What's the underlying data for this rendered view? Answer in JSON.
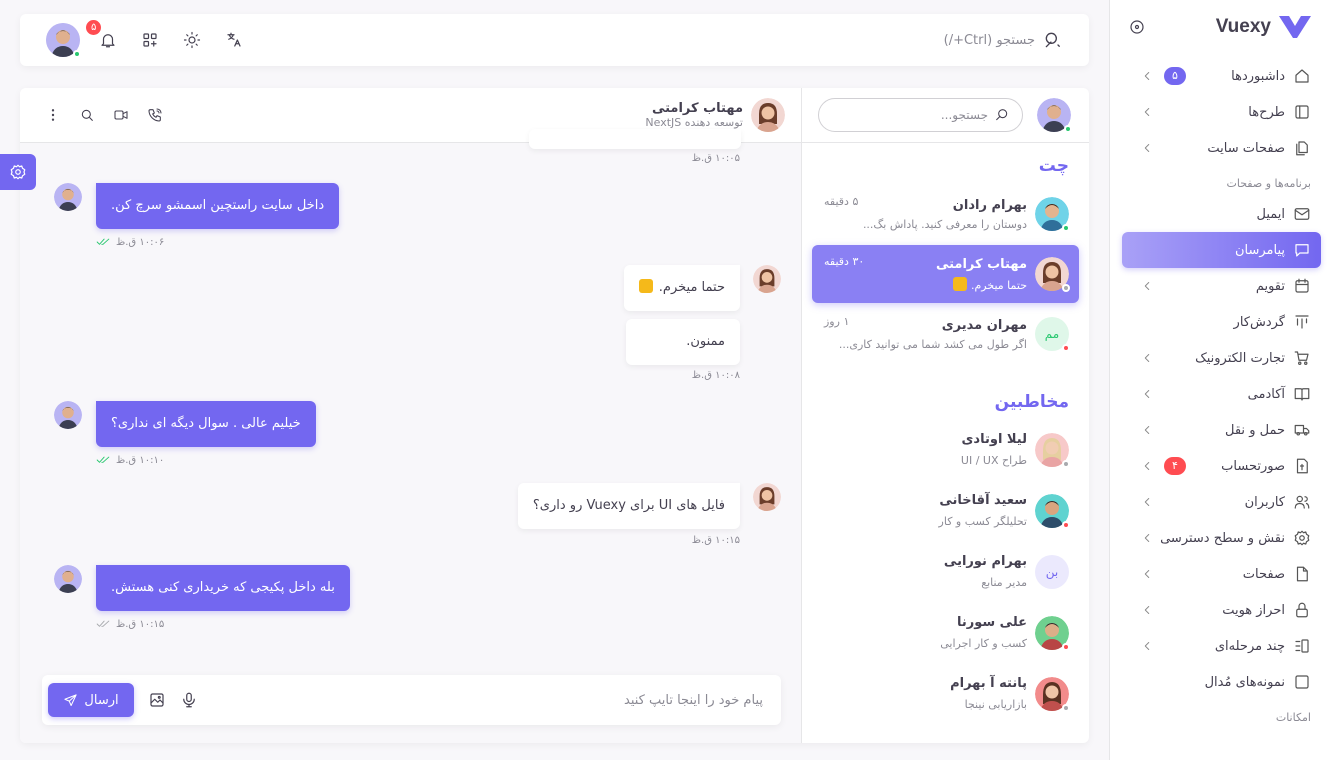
{
  "brand": {
    "name": "Vuexy"
  },
  "sidebar": {
    "items": [
      {
        "label": "داشبوردها",
        "icon": "home-icon",
        "badge": "۵",
        "badge_color": "#7367f0",
        "chevron": true
      },
      {
        "label": "طرح‌ها",
        "icon": "layout-icon",
        "chevron": true
      },
      {
        "label": "صفحات سایت",
        "icon": "files-icon",
        "chevron": true
      }
    ],
    "section_apps": "برنامه‌ها و صفحات",
    "apps": [
      {
        "label": "ایمیل",
        "icon": "mail-icon",
        "chevron": false
      },
      {
        "label": "پیامرسان",
        "icon": "message-icon",
        "chevron": false,
        "active": true
      },
      {
        "label": "تقویم",
        "icon": "calendar-icon",
        "chevron": true
      },
      {
        "label": "گردش‌کار",
        "icon": "kanban-icon",
        "chevron": false
      },
      {
        "label": "تجارت الکترونیک",
        "icon": "cart-icon",
        "chevron": true
      },
      {
        "label": "آکادمی",
        "icon": "book-icon",
        "chevron": true
      },
      {
        "label": "حمل و نقل",
        "icon": "truck-icon",
        "chevron": true
      },
      {
        "label": "صورتحساب",
        "icon": "invoice-icon",
        "badge": "۴",
        "badge_color": "#ff4c51",
        "chevron": true
      },
      {
        "label": "کاربران",
        "icon": "users-icon",
        "chevron": true
      },
      {
        "label": "نقش و سطح دسترسی",
        "icon": "settings-icon",
        "chevron": true
      },
      {
        "label": "صفحات",
        "icon": "file-icon",
        "chevron": true
      },
      {
        "label": "احراز هویت",
        "icon": "lock-icon",
        "chevron": true
      },
      {
        "label": "چند مرحله‌ای",
        "icon": "wizard-icon",
        "chevron": true
      },
      {
        "label": "نمونه‌های مُدال",
        "icon": "square-icon",
        "chevron": false
      }
    ],
    "section_features": "امکانات"
  },
  "topbar": {
    "search_placeholder": "جستجو (Ctrl+/)",
    "notif_count": "۵"
  },
  "contacts_panel": {
    "search_placeholder": "جستجو...",
    "chats_title": "چت",
    "chats": [
      {
        "name": "بهرام رادان",
        "preview": "دوستان را معرفی کنید. پاداش بگ...",
        "time": "۵ دقیقه",
        "status": "online"
      },
      {
        "name": "مهتاب کرامتی",
        "preview": "حتما میخرم.",
        "time": "۳۰ دقیقه",
        "status": "away",
        "active": true
      },
      {
        "name": "مهران مدیری",
        "preview": "اگر طول می کشد شما می توانید کاری...",
        "time": "۱ روز",
        "status": "busy",
        "initials": "مم"
      }
    ],
    "contacts_title": "مخاطبین",
    "contacts": [
      {
        "name": "لیلا اوتادی",
        "role": "طراح UI / UX",
        "status": "away"
      },
      {
        "name": "سعید آقاخانی",
        "role": "تحلیلگر کسب و کار",
        "status": "busy"
      },
      {
        "name": "بهرام نورایی",
        "role": "مدیر منابع",
        "initials": "بن"
      },
      {
        "name": "علی سورنا",
        "role": "کسب و کار اجرایی",
        "status": "busy"
      },
      {
        "name": "پانته آ بهرام",
        "role": "بازاریابی نینجا",
        "status": "away"
      }
    ]
  },
  "conversation": {
    "name": "مهتاب کرامتی",
    "subtitle": "توسعه دهنده NextJS",
    "messages": {
      "t0": "۱۰:۰۵ ق.ظ",
      "m1": "داخل سایت راستچین اسمشو سرچ کن.",
      "t1": "۱۰:۰۶ ق.ظ",
      "m2": "حتما میخرم.",
      "m3": "ممنون.",
      "t2": "۱۰:۰۸ ق.ظ",
      "m4": "خیلیم عالی . سوال دیگه ای نداری؟",
      "t3": "۱۰:۱۰ ق.ظ",
      "m5": "فایل های UI برای Vuexy رو داری؟",
      "t4": "۱۰:۱۵ ق.ظ",
      "m6": "بله داخل پکیجی که خریداری کنی هستش.",
      "t5": "۱۰:۱۵ ق.ظ"
    },
    "composer_placeholder": "پیام خود را اینجا تایپ کنید",
    "send_label": "ارسال"
  },
  "colors": {
    "primary": "#7367f0",
    "online": "#28c76f",
    "busy": "#ff4c51",
    "away": "#a8aaae"
  }
}
